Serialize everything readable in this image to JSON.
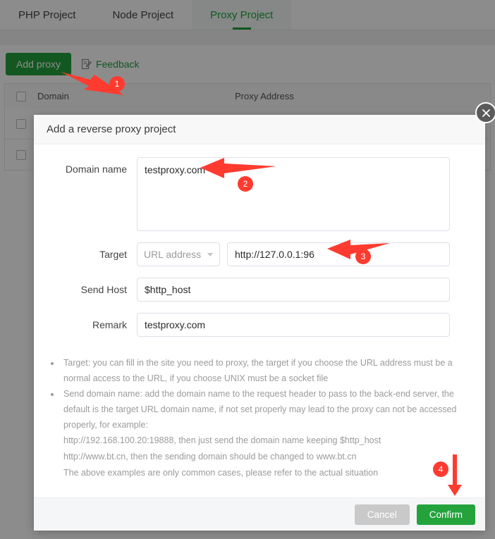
{
  "tabs": [
    {
      "label": "PHP Project",
      "active": false
    },
    {
      "label": "Node Project",
      "active": false
    },
    {
      "label": "Proxy Project",
      "active": true
    }
  ],
  "toolbar": {
    "add_proxy_label": "Add proxy",
    "feedback_label": "Feedback",
    "feedback_icon": "document-edit-icon"
  },
  "table": {
    "columns": [
      "Domain",
      "Proxy Address"
    ],
    "select_all_icon": "checkbox-icon",
    "rows": [
      {
        "checkbox": "checkbox-icon"
      },
      {
        "checkbox": "checkbox-icon"
      }
    ]
  },
  "modal": {
    "title": "Add a reverse proxy project",
    "close_icon": "close-icon",
    "fields": {
      "domain_name": {
        "label": "Domain name",
        "value": "testproxy.com",
        "placeholder": ""
      },
      "target": {
        "label": "Target",
        "select_value": "URL address",
        "select_icon": "chevron-down-icon",
        "url_value": "http://127.0.0.1:96",
        "url_placeholder": ""
      },
      "send_host": {
        "label": "Send Host",
        "value": "$http_host",
        "placeholder": ""
      },
      "remark": {
        "label": "Remark",
        "value": "testproxy.com",
        "placeholder": ""
      }
    },
    "help": {
      "bullets": [
        "Target: you can fill in the site you need to proxy, the target if you choose the URL address must be a normal access to the URL, if you choose UNIX must be a socket file",
        "Send domain name: add the domain name to the request header to pass to the back-end server, the default is the target URL domain name, if not set properly may lead to the proxy can not be accessed properly, for example:"
      ],
      "examples": [
        "http://192.168.100.20:19888, then just send the domain name keeping $http_host",
        "http://www.bt.cn, then the sending domain should be changed to www.bt.cn",
        "The above examples are only common cases, please refer to the actual situation"
      ]
    },
    "footer": {
      "cancel_label": "Cancel",
      "confirm_label": "Confirm"
    }
  },
  "annotations": {
    "markers": [
      {
        "number": "1"
      },
      {
        "number": "2"
      },
      {
        "number": "3"
      },
      {
        "number": "4"
      }
    ],
    "color": "#ff3b30"
  },
  "colors": {
    "brand_green": "#23a03c",
    "accent_red": "#ff3b30",
    "overlay": "rgba(0,0,0,0.45)"
  }
}
